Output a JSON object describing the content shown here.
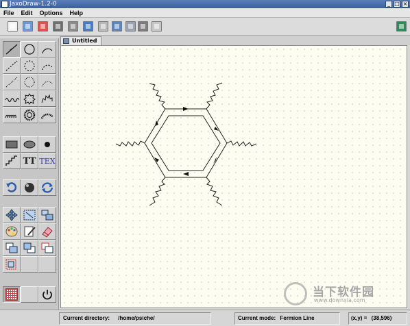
{
  "window": {
    "title": "JaxoDraw-1.2-0"
  },
  "menus": [
    "File",
    "Edit",
    "Options",
    "Help"
  ],
  "toolbar": {
    "buttons": [
      "new-icon",
      "open-icon",
      "close-icon",
      "save-icon",
      "save-as-icon",
      "export-icon",
      "print-icon",
      "print-preview-icon",
      "preview-icon",
      "preferences-icon",
      "copy-icon"
    ],
    "right_button": "help-book-icon"
  },
  "tab": {
    "label": "Untitled"
  },
  "palette": {
    "text_tool": "TT",
    "tex_tool": "TEX",
    "selected_tool": "fermion-line"
  },
  "status": {
    "directory_label": "Current directory:",
    "directory_value": "/home/psiche/",
    "mode_label": "Current mode:",
    "mode_value": "Fermion Line",
    "coords_label": "(x,y) =",
    "coords_value": "(38,596)"
  },
  "watermark": {
    "text": "当下软件园",
    "url": "www.downxia.com"
  },
  "colors": {
    "canvas": "#fefdf2",
    "grid_dot": "#a7a7a7",
    "accent": "#3c5f9e"
  }
}
